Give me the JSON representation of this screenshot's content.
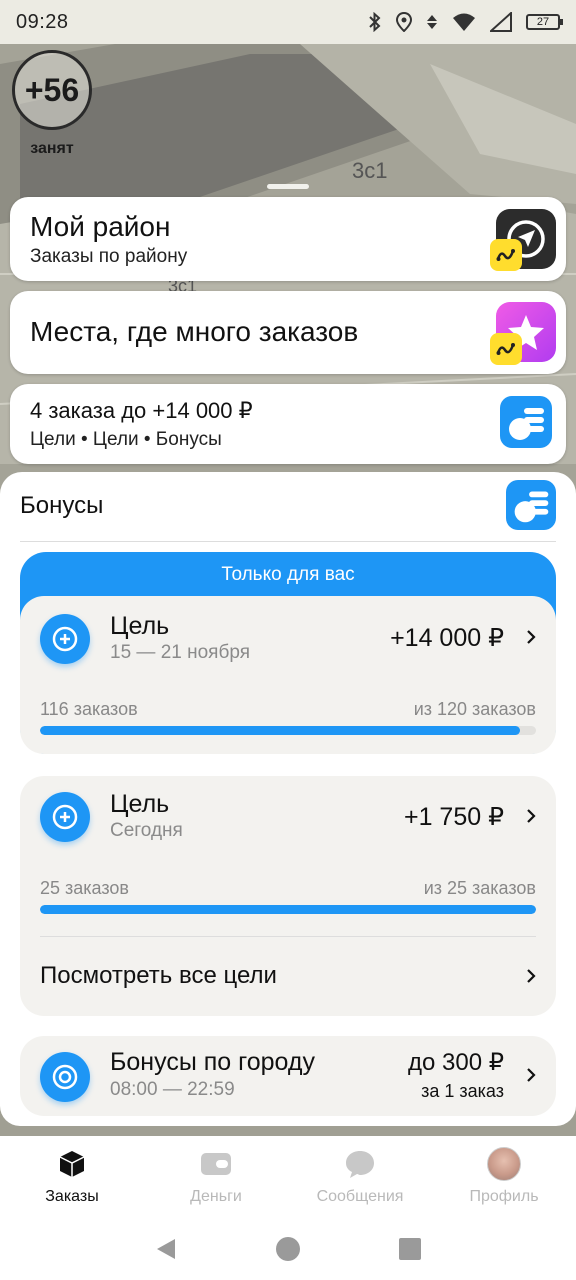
{
  "status_bar": {
    "time": "09:28",
    "battery": "27"
  },
  "map": {
    "building_label_1": "3с1",
    "building_label_2": "3с1"
  },
  "driver_status": {
    "score": "+56",
    "state": "занят"
  },
  "cards": {
    "my_district": {
      "title": "Мой район",
      "subtitle": "Заказы по району"
    },
    "hot_places": {
      "title": "Места, где много заказов"
    },
    "goals_summary": {
      "title": "4 заказа до +14 000 ₽",
      "subtitle": "Цели • Цели • Бонусы"
    }
  },
  "bonuses": {
    "title": "Бонусы",
    "exclusive_label": "Только для вас",
    "goals": [
      {
        "title": "Цель",
        "dates": "15 — 21 ноября",
        "amount": "+14 000 ₽",
        "done": "116 заказов",
        "total": "из 120 заказов",
        "progress": 0.967
      },
      {
        "title": "Цель",
        "dates": "Сегодня",
        "amount": "+1 750 ₽",
        "done": "25 заказов",
        "total": "из 25 заказов",
        "progress": 1.0
      }
    ],
    "view_all": "Посмотреть все цели",
    "city_bonus": {
      "title": "Бонусы по городу",
      "hours": "08:00 — 22:59",
      "amount": "до 300 ₽",
      "per": "за 1 заказ"
    }
  },
  "nav": {
    "orders": "Заказы",
    "money": "Деньги",
    "messages": "Сообщения",
    "profile": "Профиль"
  },
  "colors": {
    "accent": "#1e96f5",
    "yellow": "#ffdd2d",
    "purple": "#d84ee8"
  }
}
